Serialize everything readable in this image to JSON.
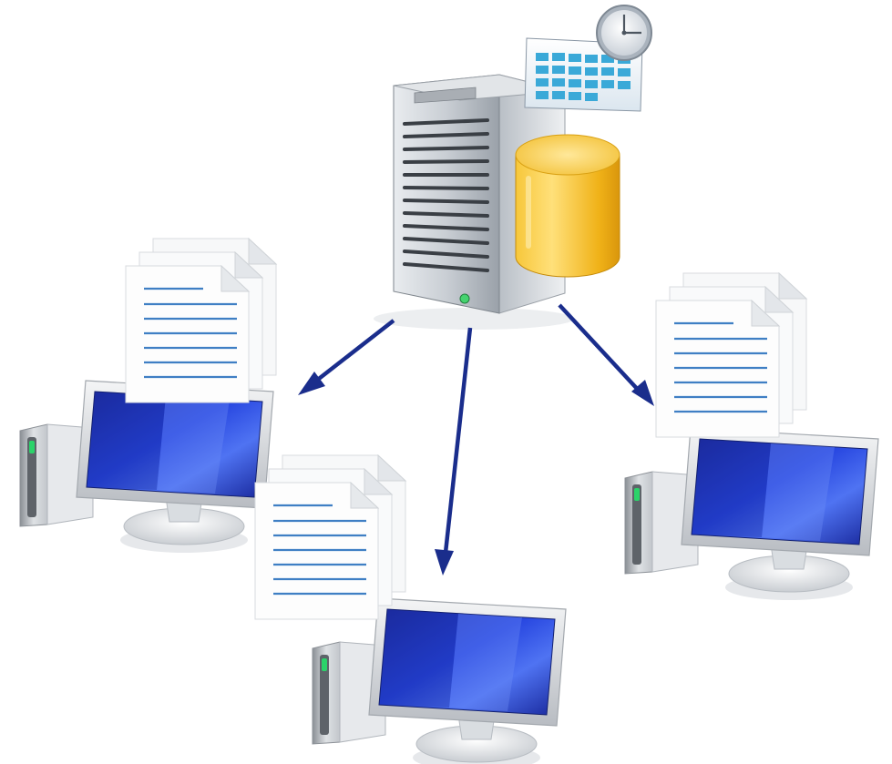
{
  "diagram": {
    "type": "server-distribution",
    "server": {
      "icons": [
        "server-tower-icon",
        "database-icon",
        "calendar-icon",
        "clock-icon"
      ]
    },
    "clients": [
      {
        "icon": "desktop-computer-icon",
        "documents_icon": "document-stack-icon"
      },
      {
        "icon": "desktop-computer-icon",
        "documents_icon": "document-stack-icon"
      },
      {
        "icon": "desktop-computer-icon",
        "documents_icon": "document-stack-icon"
      }
    ],
    "arrow_color": "#1a2d8c",
    "screen_color": "#1b2fc4",
    "database_color": "#f2bd22"
  }
}
